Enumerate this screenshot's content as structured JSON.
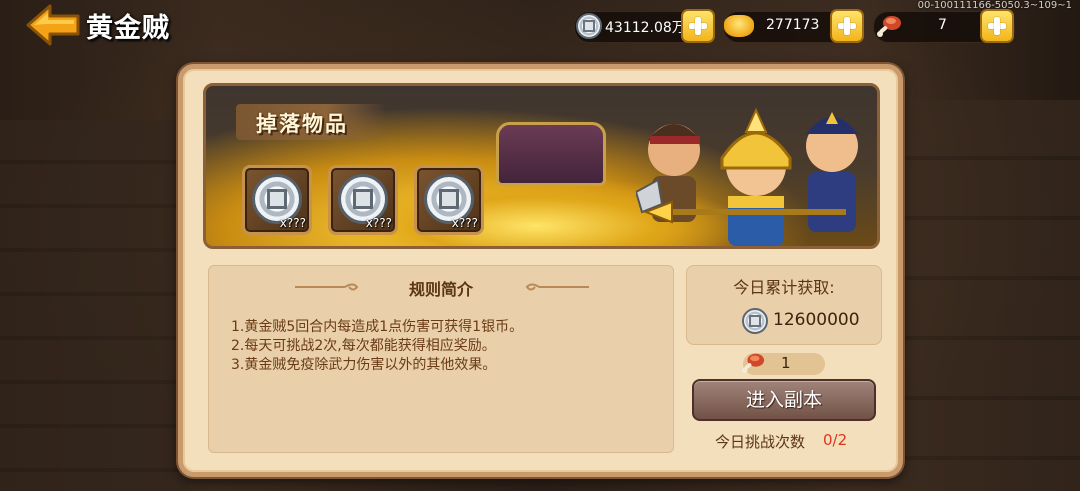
{
  "header": {
    "title": "黄金贼",
    "silver": "43112.08万",
    "gold": "277173",
    "stamina": "7",
    "account_id": "00-100111166-5050.3~109~1"
  },
  "banner": {
    "drop_title": "掉落物品",
    "drop_items": [
      {
        "icon": "silver-coin-icon",
        "qty": "x???"
      },
      {
        "icon": "silver-coin-icon",
        "qty": "x???"
      },
      {
        "icon": "silver-coin-icon",
        "qty": "x???"
      }
    ]
  },
  "rules": {
    "title": "规则简介",
    "lines": [
      "1.黄金贼5回合内每造成1点伤害可获得1银币。",
      "2.每天可挑战2次,每次都能获得相应奖励。",
      "3.黄金贼免疫除武力伤害以外的其他效果。"
    ]
  },
  "daily": {
    "label": "今日累计获取:",
    "value": "12600000"
  },
  "entry": {
    "cost": "1",
    "button_label": "进入副本",
    "challenge_label": "今日挑战次数",
    "challenge_count": "0/2"
  },
  "colors": {
    "accent_gold": "#f2b51c",
    "panel_bg": "#f4dfbd",
    "text_brown": "#5a3516",
    "count_red": "#d9361c"
  }
}
